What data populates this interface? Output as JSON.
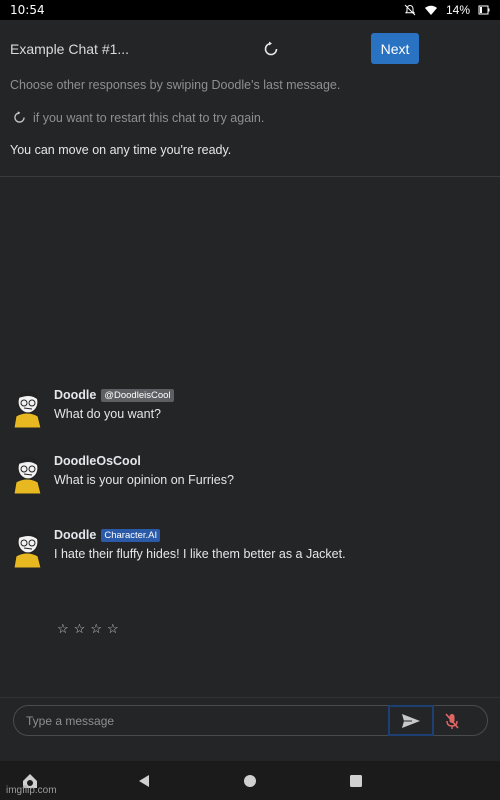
{
  "status_bar": {
    "time": "10:54",
    "battery": "14%"
  },
  "header": {
    "chat_title": "Example Chat #1...",
    "next_label": "Next",
    "hint_swipe": "Choose other responses by swiping Doodle's last message.",
    "hint_restart": "if you want to restart this chat to try again.",
    "hint_ready": "You can move on any time you're ready."
  },
  "messages": [
    {
      "name": "Doodle",
      "tag": "@DoodleisCool",
      "text": "What do you want?"
    },
    {
      "name": "DoodleOsCool",
      "tag": "",
      "text": "What is your opinion on Furries?"
    },
    {
      "name": "Doodle",
      "tag": "Character.AI",
      "text": "I hate their fluffy hides! I like them better as a Jacket."
    }
  ],
  "rating": {
    "stars": [
      "☆",
      "☆",
      "☆",
      "☆"
    ]
  },
  "input": {
    "placeholder": "Type a message"
  },
  "watermark": "imgflip.com",
  "colors": {
    "accent": "#2a73c3",
    "background": "#242526",
    "mic_muted": "#e06666"
  }
}
